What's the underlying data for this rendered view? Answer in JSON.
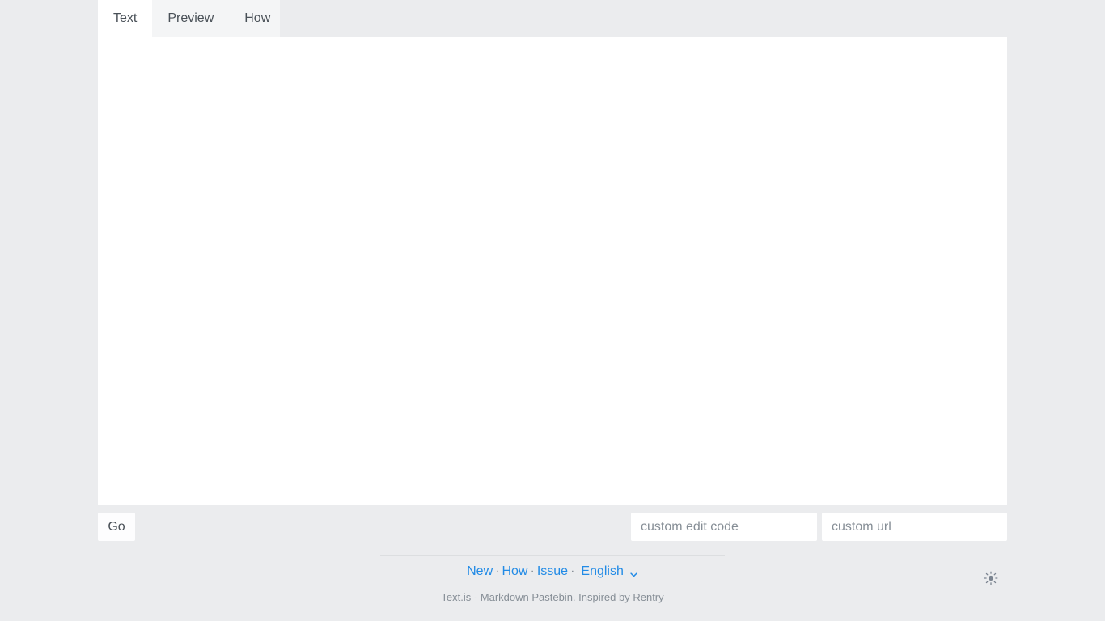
{
  "tabs": [
    {
      "id": "text",
      "label": "Text",
      "active": true
    },
    {
      "id": "preview",
      "label": "Preview",
      "active": false
    },
    {
      "id": "how",
      "label": "How",
      "active": false
    }
  ],
  "editor": {
    "value": "",
    "placeholder": ""
  },
  "controls": {
    "go_label": "Go",
    "edit_code_placeholder": "custom edit code",
    "edit_code_value": "",
    "url_placeholder": "custom url",
    "url_value": ""
  },
  "footer": {
    "links": [
      {
        "id": "new",
        "label": "New"
      },
      {
        "id": "how",
        "label": "How"
      },
      {
        "id": "issue",
        "label": "Issue"
      }
    ],
    "separator": "·",
    "language": {
      "label": "English",
      "icon": "chevron-down-icon"
    },
    "tagline": "Text.is - Markdown Pastebin. Inspired by Rentry"
  },
  "theme_toggle": {
    "icon": "sun-icon",
    "title": "Light mode"
  },
  "colors": {
    "page_background": "#ebecee",
    "tabbar_background": "#f4f5f6",
    "active_tab_background": "#ffffff",
    "editor_background": "#ffffff",
    "link": "#228be6",
    "text": "#495057",
    "muted": "#868e96",
    "divider": "#dcdee0"
  }
}
